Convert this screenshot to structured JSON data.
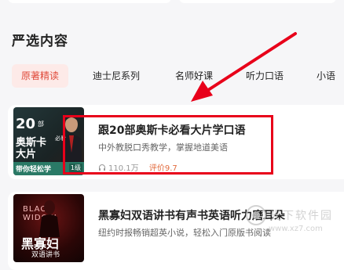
{
  "section": {
    "title": "严选内容"
  },
  "tabs": [
    {
      "label": "原著精读",
      "active": true
    },
    {
      "label": "迪士尼系列",
      "active": false
    },
    {
      "label": "名师好课",
      "active": false
    },
    {
      "label": "听力口语",
      "active": false
    },
    {
      "label": "小语",
      "active": false
    }
  ],
  "courses": [
    {
      "title": "跟20部奥斯卡必看大片学口语",
      "description": "中外教脱口秀教学，掌握地道美语",
      "listens": "110.1万",
      "rating": "评价9.7",
      "cover": {
        "number": "20",
        "unit": "部",
        "line1": "奥斯卡",
        "line2": "大片",
        "tag": "必看",
        "band": "带你轻松学",
        "level": "1级"
      }
    },
    {
      "title": "黑寡妇双语讲书有声书英语听力磨耳朵",
      "description": "纽约时报畅销超英小说，轻松入门原版书阅读",
      "cover": {
        "english": "BLACK WIDOW",
        "big": "黑寡妇",
        "small": "双语讲书"
      }
    }
  ],
  "watermark": {
    "name": "光下软件园",
    "url": "www.xz7.com"
  },
  "colors": {
    "accent": "#e04a3a",
    "highlight": "#e8001a",
    "rating": "#e26a3c"
  }
}
